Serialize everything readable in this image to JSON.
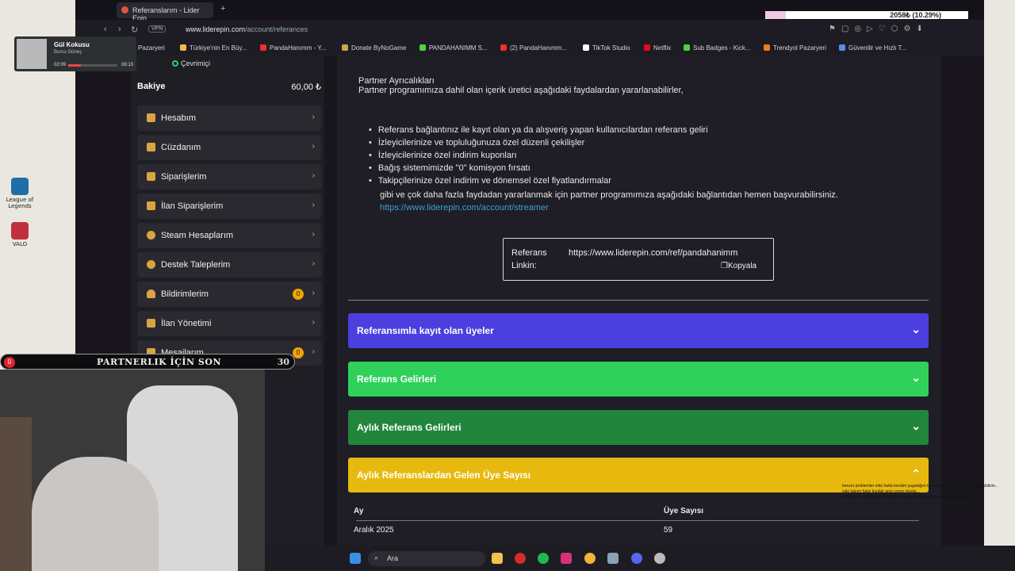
{
  "browser": {
    "tab_title": "Referanslarım - Lider Epin",
    "url_host": "www.liderepin.com",
    "url_path": "/account/referances",
    "vpn_label": "VPN"
  },
  "bookmarks": [
    {
      "label": "l Pazaryeri",
      "color": "#e9a33b"
    },
    {
      "label": "Türkiye'nin En Büy...",
      "color": "#f2b84b"
    },
    {
      "label": "PandaHanımm - Y...",
      "color": "#ff2a2a"
    },
    {
      "label": "Donate ByNoGame",
      "color": "#cfa54a"
    },
    {
      "label": "PANDAHANIMM S...",
      "color": "#4fd13f"
    },
    {
      "label": "(2) PandaHanımm...",
      "color": "#ff2a2a"
    },
    {
      "label": "TikTok Studio",
      "color": "#ffffff"
    },
    {
      "label": "Netflix",
      "color": "#e50914"
    },
    {
      "label": "Sub Badges - Kick...",
      "color": "#4fd13f"
    },
    {
      "label": "Trendyol Pazaryeri",
      "color": "#f27a1a"
    },
    {
      "label": "Güvenilir ve Hızlı T...",
      "color": "#5a8be8"
    }
  ],
  "sidebar": {
    "status": "Çevrimiçi",
    "balance_label": "Bakiye",
    "balance_value": "60,00 ₺",
    "items": [
      {
        "label": "Hesabım",
        "icon": "user-icon"
      },
      {
        "label": "Cüzdanım",
        "icon": "wallet-icon"
      },
      {
        "label": "Siparişlerim",
        "icon": "cart-icon"
      },
      {
        "label": "İlan Siparişlerim",
        "icon": "bag-icon"
      },
      {
        "label": "Steam Hesaplarım",
        "icon": "steam-icon"
      },
      {
        "label": "Destek Taleplerim",
        "icon": "headset-icon"
      },
      {
        "label": "Bildirimlerim",
        "icon": "bell-icon",
        "badge": "0"
      },
      {
        "label": "İlan Yönetimi",
        "icon": "store-icon"
      },
      {
        "label": "Mesajlarım",
        "icon": "message-icon",
        "badge": "0"
      }
    ]
  },
  "content": {
    "partner_title": "Partner Ayrıcalıkları",
    "partner_intro": "Partner programımıza dahil olan içerik üretici aşağıdaki faydalardan yararlanabilirler,",
    "benefits": [
      "Referans bağlantınız ile kayıt olan ya da alışveriş yapan kullanıcılardan referans geliri",
      "İzleyicilerinize ve topluluğunuza özel düzenli çekilişler",
      "İzleyicilerinize özel indirim kuponları",
      "Bağış sistemimizde \"0\" komisyon fırsatı",
      "Takipçilerinize özel indirim ve dönemsel özel fiyatlandırmalar"
    ],
    "benefits_tail": "gibi ve çok daha fazla faydadan yararlanmak için partner programımıza aşağıdaki bağlantıdan hemen başvurabilirsiniz.",
    "streamer_link": "https://www.liderepin.com/account/streamer",
    "ref_label_1": "Referans",
    "ref_label_2": "Linkin:",
    "ref_url": "https://www.liderepin.com/ref/pandahanimm",
    "copy_label": "Kopyala",
    "accordions": [
      {
        "label": "Referansımla kayıt olan üyeler",
        "color": "#4b3fe0",
        "state": "collapsed"
      },
      {
        "label": "Referans Gelirleri",
        "color": "#2fd15b",
        "state": "collapsed"
      },
      {
        "label": "Aylık Referans Gelirleri",
        "color": "#21853c",
        "state": "collapsed"
      },
      {
        "label": "Aylık Referanslardan Gelen Üye Sayısı",
        "color": "#e7b90f",
        "state": "expanded"
      }
    ],
    "table": {
      "col_month": "Ay",
      "col_count": "Üye Sayısı",
      "rows": [
        {
          "month": "Aralık 2025",
          "count": "59"
        }
      ]
    }
  },
  "overlays": {
    "music_title": "Gül Kokusu",
    "music_artist": "Burcu Güneş",
    "music_elapsed": "02:09",
    "music_total": "08:13",
    "music_progress": 0.26,
    "banner_title": "PARTNERLIK İÇİN SON",
    "banner_count": "30",
    "banner_badge": "0",
    "xp_label": "2058₺ (10.29%)",
    "xp_progress": 0.1029,
    "chat_lines": [
      "benzer problemler oldu hatta kendim yaşadığım bir saçma olayı size de de anlatabilirim...",
      "valo takımı falan kurduk ama sonra olaylar...",
      "pandikbey: abla benda anlatıyım bi abiyle tanışmıştım mahmut abi valoda..."
    ]
  },
  "desktop": {
    "icon1": "League of Legends",
    "icon2": "VALO"
  },
  "taskbar": {
    "search_placeholder": "Ara"
  }
}
